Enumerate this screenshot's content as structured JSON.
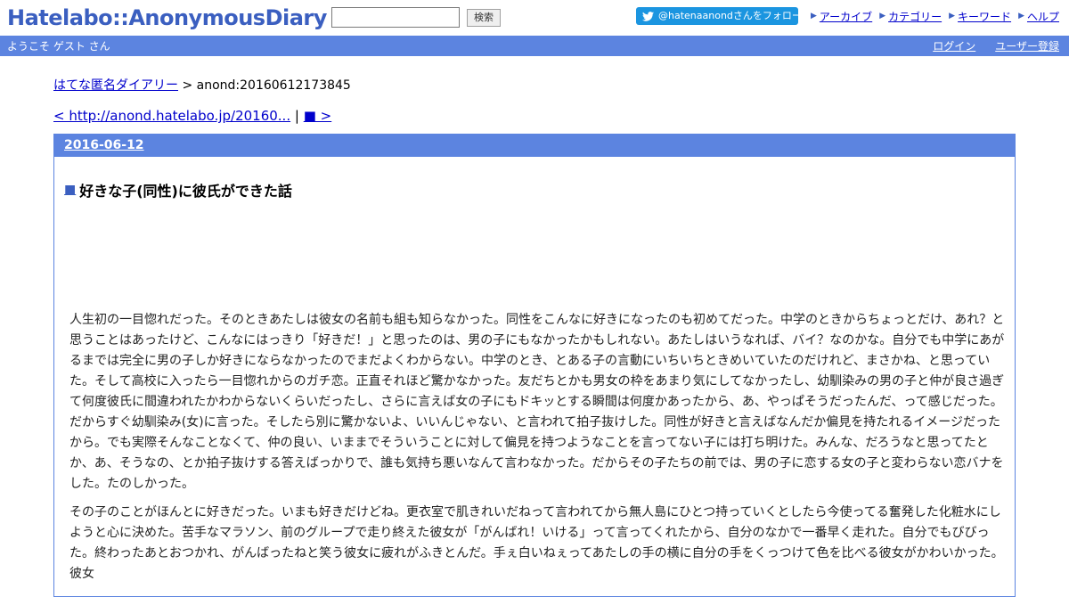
{
  "header": {
    "logo": "Hatelabo::AnonymousDiary",
    "search_placeholder": "",
    "search_button": "検索",
    "follow_label": "@hatenaanondさんをフォロー",
    "nav": [
      {
        "label": "アーカイブ"
      },
      {
        "label": "カテゴリー"
      },
      {
        "label": "キーワード"
      },
      {
        "label": "ヘルプ"
      }
    ]
  },
  "strip": {
    "welcome": "ようこそ ゲスト さん",
    "login": "ログイン",
    "register": "ユーザー登録"
  },
  "breadcrumb": {
    "home": "はてな匿名ダイアリー",
    "separator": " > ",
    "current": "anond:20160612173845"
  },
  "pager": {
    "prev": "< http://anond.hatelabo.jp/20160...",
    "separator": " | ",
    "next": "■ >"
  },
  "entry": {
    "date": "2016-06-12",
    "title_mark": "■",
    "title": "好きな子(同性)に彼氏ができた話",
    "paragraphs": [
      "人生初の一目惚れだった。そのときあたしは彼女の名前も組も知らなかった。同性をこんなに好きになったのも初めてだった。中学のときからちょっとだけ、あれ？と思うことはあったけど、こんなにはっきり「好きだ！」と思ったのは、男の子にもなかったかもしれない。あたしはいうなれば、バイ？なのかな。自分でも中学にあがるまでは完全に男の子しか好きにならなかったのでまだよくわからない。中学のとき、とある子の言動にいちいちときめいていたのだけれど、まさかね、と思っていた。そして高校に入ったら一目惚れからのガチ恋。正直それほど驚かなかった。友だちとかも男女の枠をあまり気にしてなかったし、幼馴染みの男の子と仲が良さ過ぎて何度彼氏に間違われたかわからないくらいだったし、さらに言えば女の子にもドキッとする瞬間は何度かあったから、あ、やっぱそうだったんだ、って感じだった。だからすぐ幼馴染み(女)に言った。そしたら別に驚かないよ、いいんじゃない、と言われて拍子抜けした。同性が好きと言えばなんだか偏見を持たれるイメージだったから。でも実際そんなことなくて、仲の良い、いままでそういうことに対して偏見を持つようなことを言ってない子には打ち明けた。みんな、だろうなと思ってたとか、あ、そうなの、とか拍子抜けする答えばっかりで、誰も気持ち悪いなんて言わなかった。だからその子たちの前では、男の子に恋する女の子と変わらない恋バナをした。たのしかった。",
      "その子のことがほんとに好きだった。いまも好きだけどね。更衣室で肌きれいだねって言われてから無人島にひとつ持っていくとしたら今使ってる奮発した化粧水にしようと心に決めた。苦手なマラソン、前のグループで走り終えた彼女が「がんばれ！いける」って言ってくれたから、自分のなかで一番早く走れた。自分でもびびった。終わったあとおつかれ、がんばったねと笑う彼女に疲れがふきとんだ。手ぇ白いねぇってあたしの手の横に自分の手をくっつけて色を比べる彼女がかわいかった。彼女"
    ]
  }
}
